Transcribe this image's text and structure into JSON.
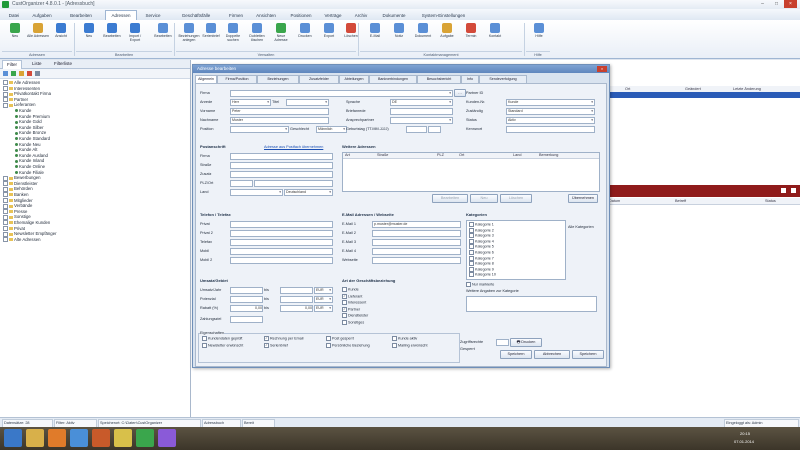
{
  "window": {
    "title": "CustOrganizer 4.8.0.1 - [Adressbuch]",
    "controls": [
      "–",
      "□",
      "×"
    ]
  },
  "menu_tabs": [
    {
      "label": "Datei"
    },
    {
      "label": "Aufgaben"
    },
    {
      "label": "Bearbeiten"
    },
    {
      "label": "Adressen"
    },
    {
      "label": "Service"
    },
    {
      "label": "Geschäftsfälle"
    },
    {
      "label": "Firmen"
    },
    {
      "label": "Ansichten"
    },
    {
      "label": "Positionen"
    },
    {
      "label": "Verträge"
    },
    {
      "label": "Archiv"
    },
    {
      "label": "Dokumente"
    },
    {
      "label": "System-Einstellungen"
    }
  ],
  "ribbon": {
    "buttons": [
      {
        "label": "Neu",
        "icon": "new-icon",
        "color": "#3aa64c"
      },
      {
        "label": "Alle Adressen",
        "icon": "group-icon",
        "color": "#d9a335"
      },
      {
        "label": "Ansicht",
        "icon": "view-icon",
        "color": "#3b7bd1"
      },
      {
        "label": "Neu",
        "icon": "add-icon",
        "color": "#3b7bd1"
      },
      {
        "label": "Bearbeiten",
        "icon": "edit-icon",
        "color": "#3b7bd1"
      },
      {
        "label": "Import / Export",
        "icon": "import-icon",
        "color": "#3b7bd1"
      },
      {
        "label": "Bearbeiten",
        "icon": "pencil-icon",
        "color": "#5a8fd6"
      },
      {
        "label": "Beziehungen anlegen",
        "icon": "link-icon",
        "color": "#5a8fd6"
      },
      {
        "label": "Serienbrief",
        "icon": "letter-icon",
        "color": "#5a8fd6"
      },
      {
        "label": "Doppelte suchen",
        "icon": "duplicate-icon",
        "color": "#5a8fd6"
      },
      {
        "label": "Dubletten löschen",
        "icon": "merge-icon",
        "color": "#5a8fd6"
      },
      {
        "label": "Neue Adresse",
        "icon": "person-icon",
        "color": "#3aa64c"
      },
      {
        "label": "Drucken",
        "icon": "print-icon",
        "color": "#5a8fd6"
      },
      {
        "label": "Export",
        "icon": "export-icon",
        "color": "#5a8fd6"
      },
      {
        "label": "Löschen",
        "icon": "delete-icon",
        "color": "#d34a3a"
      },
      {
        "label": "E-Mail",
        "icon": "mail-icon",
        "color": "#5a8fd6"
      },
      {
        "label": "Notiz",
        "icon": "note-icon",
        "color": "#5a8fd6"
      },
      {
        "label": "Dokument",
        "icon": "document-icon",
        "color": "#5a8fd6"
      },
      {
        "label": "Aufgabe",
        "icon": "task-icon",
        "color": "#d9a335"
      },
      {
        "label": "Termin",
        "icon": "calendar-icon",
        "color": "#d34a3a"
      },
      {
        "label": "Kontakt",
        "icon": "contact-icon",
        "color": "#5a8fd6"
      },
      {
        "label": "Hilfe",
        "icon": "help-icon",
        "color": "#5a8fd6"
      }
    ],
    "groups": [
      "Adressen",
      "Bearbeiten",
      "Verwalten",
      "Kontaktmanagement",
      "Hilfe"
    ]
  },
  "left_panel": {
    "tabs": [
      "Filter",
      "Liste",
      "Filterliste"
    ],
    "tree": [
      {
        "label": "Alle Adressen",
        "level": 0,
        "kind": "folder"
      },
      {
        "label": "Interessenten",
        "level": 0,
        "kind": "folder"
      },
      {
        "label": "Privatkontakt Firma",
        "level": 0,
        "kind": "folder"
      },
      {
        "label": "Partner",
        "level": 0,
        "kind": "folder"
      },
      {
        "label": "Lieferanten",
        "level": 0,
        "kind": "folder"
      },
      {
        "label": "Kunde",
        "level": 1,
        "kind": "person"
      },
      {
        "label": "Kunde Premium",
        "level": 1,
        "kind": "person"
      },
      {
        "label": "Kunde Gold",
        "level": 1,
        "kind": "person"
      },
      {
        "label": "Kunde Silber",
        "level": 1,
        "kind": "person"
      },
      {
        "label": "Kunde Bronze",
        "level": 1,
        "kind": "person"
      },
      {
        "label": "Kunde Standard",
        "level": 1,
        "kind": "person"
      },
      {
        "label": "Kunde Neu",
        "level": 1,
        "kind": "person"
      },
      {
        "label": "Kunde Alt",
        "level": 1,
        "kind": "person"
      },
      {
        "label": "Kunde Ausland",
        "level": 1,
        "kind": "person"
      },
      {
        "label": "Kunde Inland",
        "level": 1,
        "kind": "person"
      },
      {
        "label": "Kunde Online",
        "level": 1,
        "kind": "person"
      },
      {
        "label": "Kunde Filiale",
        "level": 1,
        "kind": "person"
      },
      {
        "label": "Bewerbungen",
        "level": 0,
        "kind": "folder"
      },
      {
        "label": "Dienstleister",
        "level": 0,
        "kind": "folder"
      },
      {
        "label": "Behörden",
        "level": 0,
        "kind": "folder"
      },
      {
        "label": "Banken",
        "level": 0,
        "kind": "folder"
      },
      {
        "label": "Mitglieder",
        "level": 0,
        "kind": "folder"
      },
      {
        "label": "Verbände",
        "level": 0,
        "kind": "folder"
      },
      {
        "label": "Presse",
        "level": 0,
        "kind": "folder"
      },
      {
        "label": "Sonstige",
        "level": 0,
        "kind": "folder"
      },
      {
        "label": "Ehemalige Kunden",
        "level": 0,
        "kind": "folder"
      },
      {
        "label": "Privat",
        "level": 0,
        "kind": "folder"
      },
      {
        "label": "Newsletter Empfänger",
        "level": 0,
        "kind": "folder"
      },
      {
        "label": "Alte Adressen",
        "level": 0,
        "kind": "folder"
      }
    ]
  },
  "background_grid": {
    "headers_top": [
      "Ort",
      "Geändert",
      "Letzte Änderung"
    ],
    "headers_bottom": [
      "Datum",
      "Betreff",
      "Status"
    ]
  },
  "dialog": {
    "title": "Adresse bearbeiten",
    "tabs": [
      "Allgemein",
      "Firma/Position",
      "Beziehungen",
      "Zusatzfelder",
      "Abteilungen",
      "Bankverbindungen",
      "Besuchsbericht",
      "Info",
      "Sendeverfolgung"
    ],
    "fields": {
      "firma": {
        "label": "Firma",
        "value": ""
      },
      "anrede": {
        "label": "Anrede",
        "value": "Herr"
      },
      "titel": {
        "label": "Titel",
        "value": ""
      },
      "vorname": {
        "label": "Vorname",
        "value": "Peter"
      },
      "nachname": {
        "label": "Nachname",
        "value": "Muster"
      },
      "position": {
        "label": "Position",
        "value": ""
      },
      "geschlecht": {
        "label": "Geschlecht",
        "value": "Männlich"
      },
      "briefanrede": {
        "label": "Briefanrede",
        "value": ""
      },
      "sprache": {
        "label": "Sprache",
        "value": "DE"
      },
      "ansprechpartner": {
        "label": "Ansprechpartner",
        "value": ""
      },
      "kundennr": {
        "label": "Kunden-Nr.",
        "value": ""
      },
      "geburtstag": {
        "label": "Geburtstag (TT.MM.JJJJ)",
        "value": ""
      },
      "partner_id": {
        "label": "Partner ID",
        "value": ""
      },
      "kategorie": {
        "label": "Kategorie",
        "value": "Kunde"
      },
      "zuständig": {
        "label": "Zuständig",
        "value": "Standard"
      },
      "status": {
        "label": "Status",
        "value": "Aktiv"
      },
      "kennwort": {
        "label": "Kennwort",
        "value": ""
      }
    },
    "post": {
      "heading": "Postanschrift",
      "link": "Adresse aus Postfach übernehmen",
      "labels": [
        "Firma",
        "Straße",
        "Zusatz",
        "PLZ/Ort",
        "Land"
      ],
      "land_value": "Deutschland"
    },
    "weitere": {
      "heading": "Weitere Adressen",
      "columns": [
        "Art",
        "Straße",
        "PLZ",
        "Ort",
        "Land",
        "Bemerkung"
      ],
      "buttons": [
        "Bearbeiten",
        "Neu",
        "Löschen",
        "Übernehmen"
      ]
    },
    "telefon": {
      "heading": "Telefon / Telefax",
      "labels": [
        "Privat",
        "Privat 2",
        "Telefax",
        "Mobil",
        "Mobil 2"
      ]
    },
    "email": {
      "heading": "E-Mail Adressen / Webseite",
      "labels": [
        "E-Mail 1",
        "E-Mail 2",
        "E-Mail 3",
        "E-Mail 4",
        "Webseite"
      ],
      "email1_value": "p.muster@muster.de"
    },
    "kategorien": {
      "heading": "Kategorien",
      "items": [
        "Kategorie 1",
        "Kategorie 2",
        "Kategorie 3",
        "Kategorie 4",
        "Kategorie 5",
        "Kategorie 6",
        "Kategorie 7",
        "Kategorie 8",
        "Kategorie 9",
        "Kategorie 10"
      ],
      "side_label": "Alle Kategorien",
      "check_label": "Nur markierte",
      "note_label": "Weitere Angaben zur Kategorie"
    },
    "umsatz": {
      "heading": "Umsatz/Gebiet",
      "labels": [
        "Umsatz/Jahr",
        "Potenzial",
        "Rabatt (%)",
        "Zahlungsziel"
      ],
      "rabatt_value": "0,00",
      "ziel_value": "0,00",
      "currency": "EUR",
      "bis_label": "bis"
    },
    "geschaeft": {
      "heading": "Art der Geschäftsbeziehung",
      "options": [
        "Kunde",
        "Lieferant",
        "Interessent",
        "Partner",
        "Dienstleister",
        "Sonstiges"
      ]
    },
    "eigenschaften": {
      "heading": "Eigenschaften",
      "checks": [
        "Kundendaten geprüft",
        "Newsletter erwünscht",
        "Rechnung per Email",
        "Serienbrief",
        "Post gesperrt",
        "Persönliche Beziehung",
        "Kunde aktiv",
        "Mailing erwünscht"
      ],
      "status_label": "Zugriffsrechte",
      "status_value": "Öffentlich",
      "lock_label": "Gesperrt",
      "druck_label": "Drucken"
    },
    "footer_buttons": [
      "Drucken",
      "Speichern",
      "Abbrechen",
      "Speichern"
    ]
  },
  "statusbar": {
    "items": [
      "Datensätze: 28",
      "Filter: Aktiv",
      "Speicherort: C:\\Daten\\CustOrganizer",
      "Adressbuch",
      "Bereit"
    ],
    "right": "Eingeloggt als: Admin"
  },
  "taskbar": {
    "apps": [
      "start-icon",
      "explorer-icon",
      "browser-icon",
      "media-icon",
      "office-icon",
      "app-icon",
      "mail-icon",
      "paint-icon"
    ],
    "time": "20:15",
    "date": "07.01.2014"
  }
}
